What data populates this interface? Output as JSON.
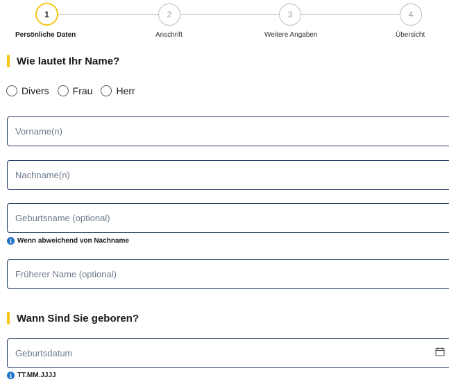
{
  "stepper": {
    "steps": [
      {
        "number": "1",
        "label": "Persönliche Daten",
        "active": true
      },
      {
        "number": "2",
        "label": "Anschrift",
        "active": false
      },
      {
        "number": "3",
        "label": "Weitere Angaben",
        "active": false
      },
      {
        "number": "4",
        "label": "Übersicht",
        "active": false
      }
    ]
  },
  "name_section": {
    "title": "Wie lautet Ihr Name?",
    "salutations": [
      "Divers",
      "Frau",
      "Herr"
    ],
    "fields": {
      "first_name": {
        "placeholder": "Vorname(n)"
      },
      "last_name": {
        "placeholder": "Nachname(n)"
      },
      "birth_name": {
        "placeholder": "Geburtsname (optional)",
        "hint": "Wenn abweichend von Nachname"
      },
      "former_name": {
        "placeholder": "Früherer Name (optional)"
      }
    }
  },
  "birth_section": {
    "title": "Wann Sind Sie geboren?",
    "date_field": {
      "placeholder": "Geburtsdatum",
      "hint": "TT.MM.JJJJ"
    }
  },
  "icons": {
    "info": "info-icon",
    "calendar": "calendar-icon"
  },
  "colors": {
    "accent": "#f5c518",
    "field_border": "#2a3f66",
    "info": "#1f73c7"
  }
}
